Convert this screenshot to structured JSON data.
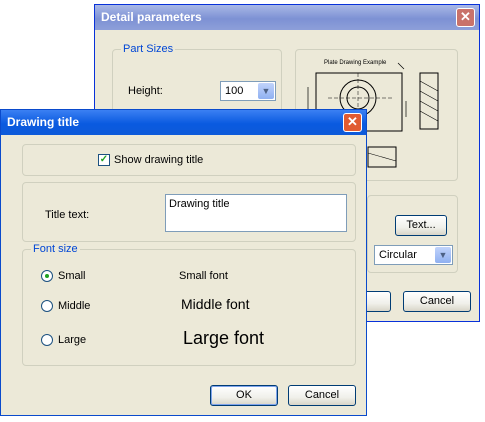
{
  "back_window": {
    "title": "Detail parameters",
    "part_sizes_legend": "Part Sizes",
    "height_label": "Height:",
    "height_value": "100",
    "preview_caption": "Plate Drawing Example",
    "text_button": "Text...",
    "shape_value": "Circular",
    "cancel_label": "Cancel"
  },
  "front_window": {
    "title": "Drawing title",
    "show_title_label": "Show drawing title",
    "show_title_checked": true,
    "title_text_label": "Title text:",
    "title_text_value": "Drawing title",
    "font_size_legend": "Font size",
    "options": [
      {
        "label": "Small",
        "sample": "Small font",
        "selected": true
      },
      {
        "label": "Middle",
        "sample": "Middle font",
        "selected": false
      },
      {
        "label": "Large",
        "sample": "Large font",
        "selected": false
      }
    ],
    "ok_label": "OK",
    "cancel_label": "Cancel"
  }
}
